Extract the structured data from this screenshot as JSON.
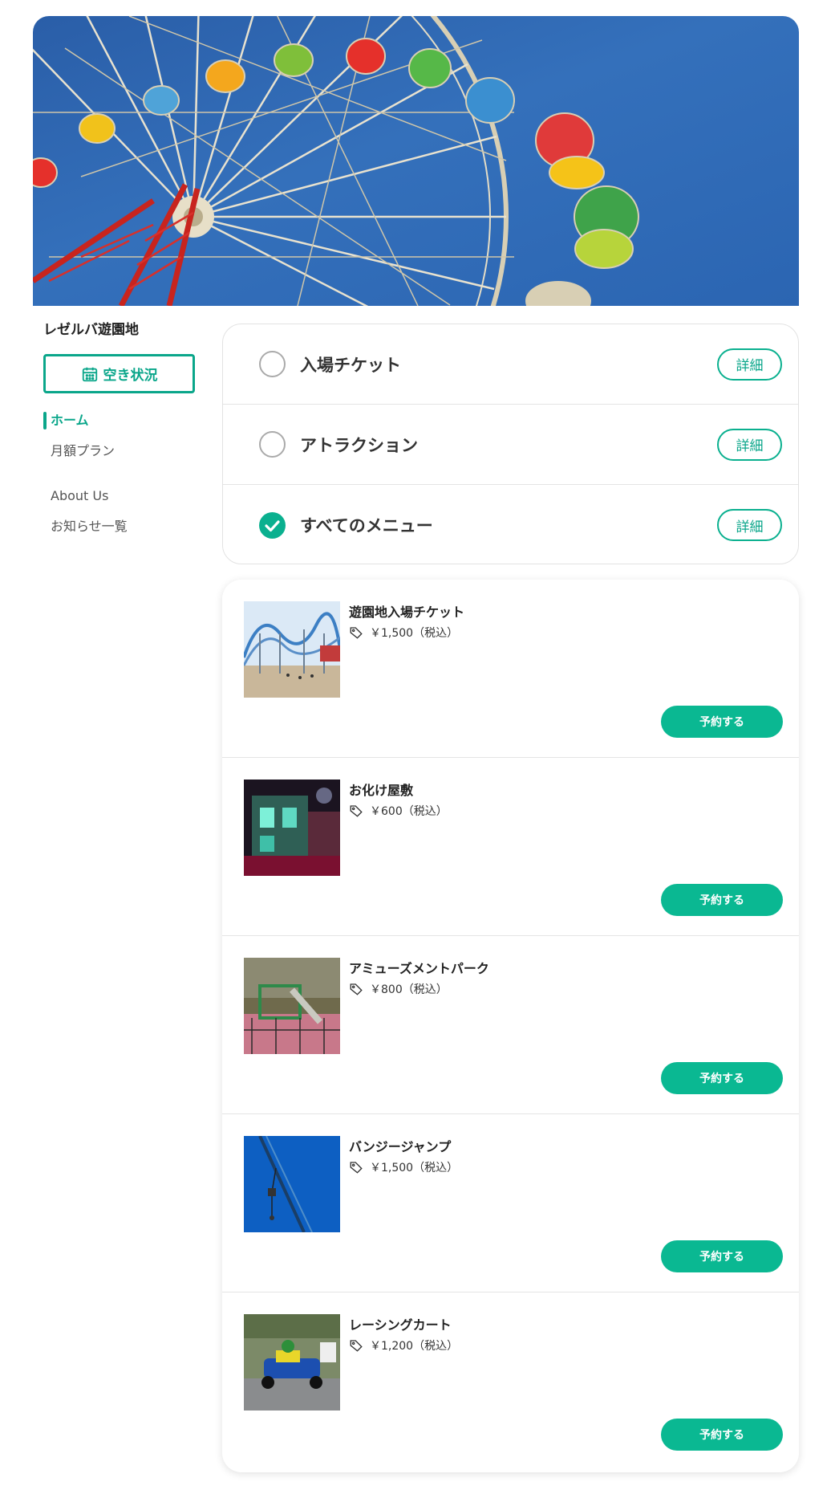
{
  "hero": {
    "image": "ferris-wheel-photo"
  },
  "sidebar": {
    "site_title": "レゼルバ遊園地",
    "availability_button": "空き状況",
    "availability_icon": "calendar-icon",
    "nav": [
      {
        "label": "ホーム",
        "active": true
      },
      {
        "label": "月額プラン",
        "active": false
      },
      {
        "label": "About Us",
        "active": false
      },
      {
        "label": "お知らせ一覧",
        "active": false
      }
    ]
  },
  "categories": [
    {
      "label": "入場チケット",
      "selected": false,
      "detail_label": "詳細"
    },
    {
      "label": "アトラクション",
      "selected": false,
      "detail_label": "詳細"
    },
    {
      "label": "すべてのメニュー",
      "selected": true,
      "detail_label": "詳細"
    }
  ],
  "menu_items": [
    {
      "name": "遊園地入場チケット",
      "price": "￥1,500（税込）",
      "button": "予約する",
      "image": "roller-coaster-photo"
    },
    {
      "name": "お化け屋敷",
      "price": "￥600（税込）",
      "button": "予約する",
      "image": "haunted-house-photo"
    },
    {
      "name": "アミューズメントパーク",
      "price": "￥800（税込）",
      "button": "予約する",
      "image": "playground-photo"
    },
    {
      "name": "バンジージャンプ",
      "price": "￥1,500（税込）",
      "button": "予約する",
      "image": "bungee-jump-photo"
    },
    {
      "name": "レーシングカート",
      "price": "￥1,200（税込）",
      "button": "予約する",
      "image": "racing-kart-photo"
    }
  ],
  "colors": {
    "accent": "#0ab08f",
    "accent_text": "#0aa68a",
    "sky": "#2f6cb5"
  }
}
